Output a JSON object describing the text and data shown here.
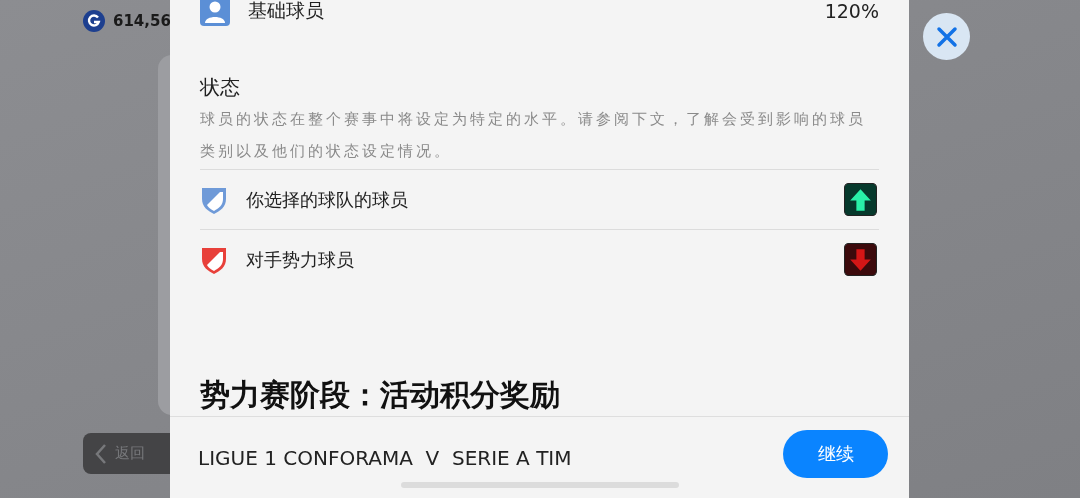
{
  "background": {
    "coins": "614,56",
    "back_button": "返回"
  },
  "modal": {
    "base_player": {
      "label": "基础球员",
      "value": "120%"
    },
    "condition": {
      "title": "状态",
      "description": "球员的状态在整个赛事中将设定为特定的水平。请参阅下文，了解会受到影响的球员类别以及他们的状态设定情况。",
      "items": [
        {
          "label": "你选择的球队的球员",
          "kind": "up"
        },
        {
          "label": "对手势力球员",
          "kind": "down"
        }
      ]
    },
    "next_heading": "势力赛阶段：活动积分奖励",
    "footer": {
      "matchup": "LIGUE 1 CONFORAMA  V  SERIE A TIM",
      "continue_button": "继续"
    }
  }
}
